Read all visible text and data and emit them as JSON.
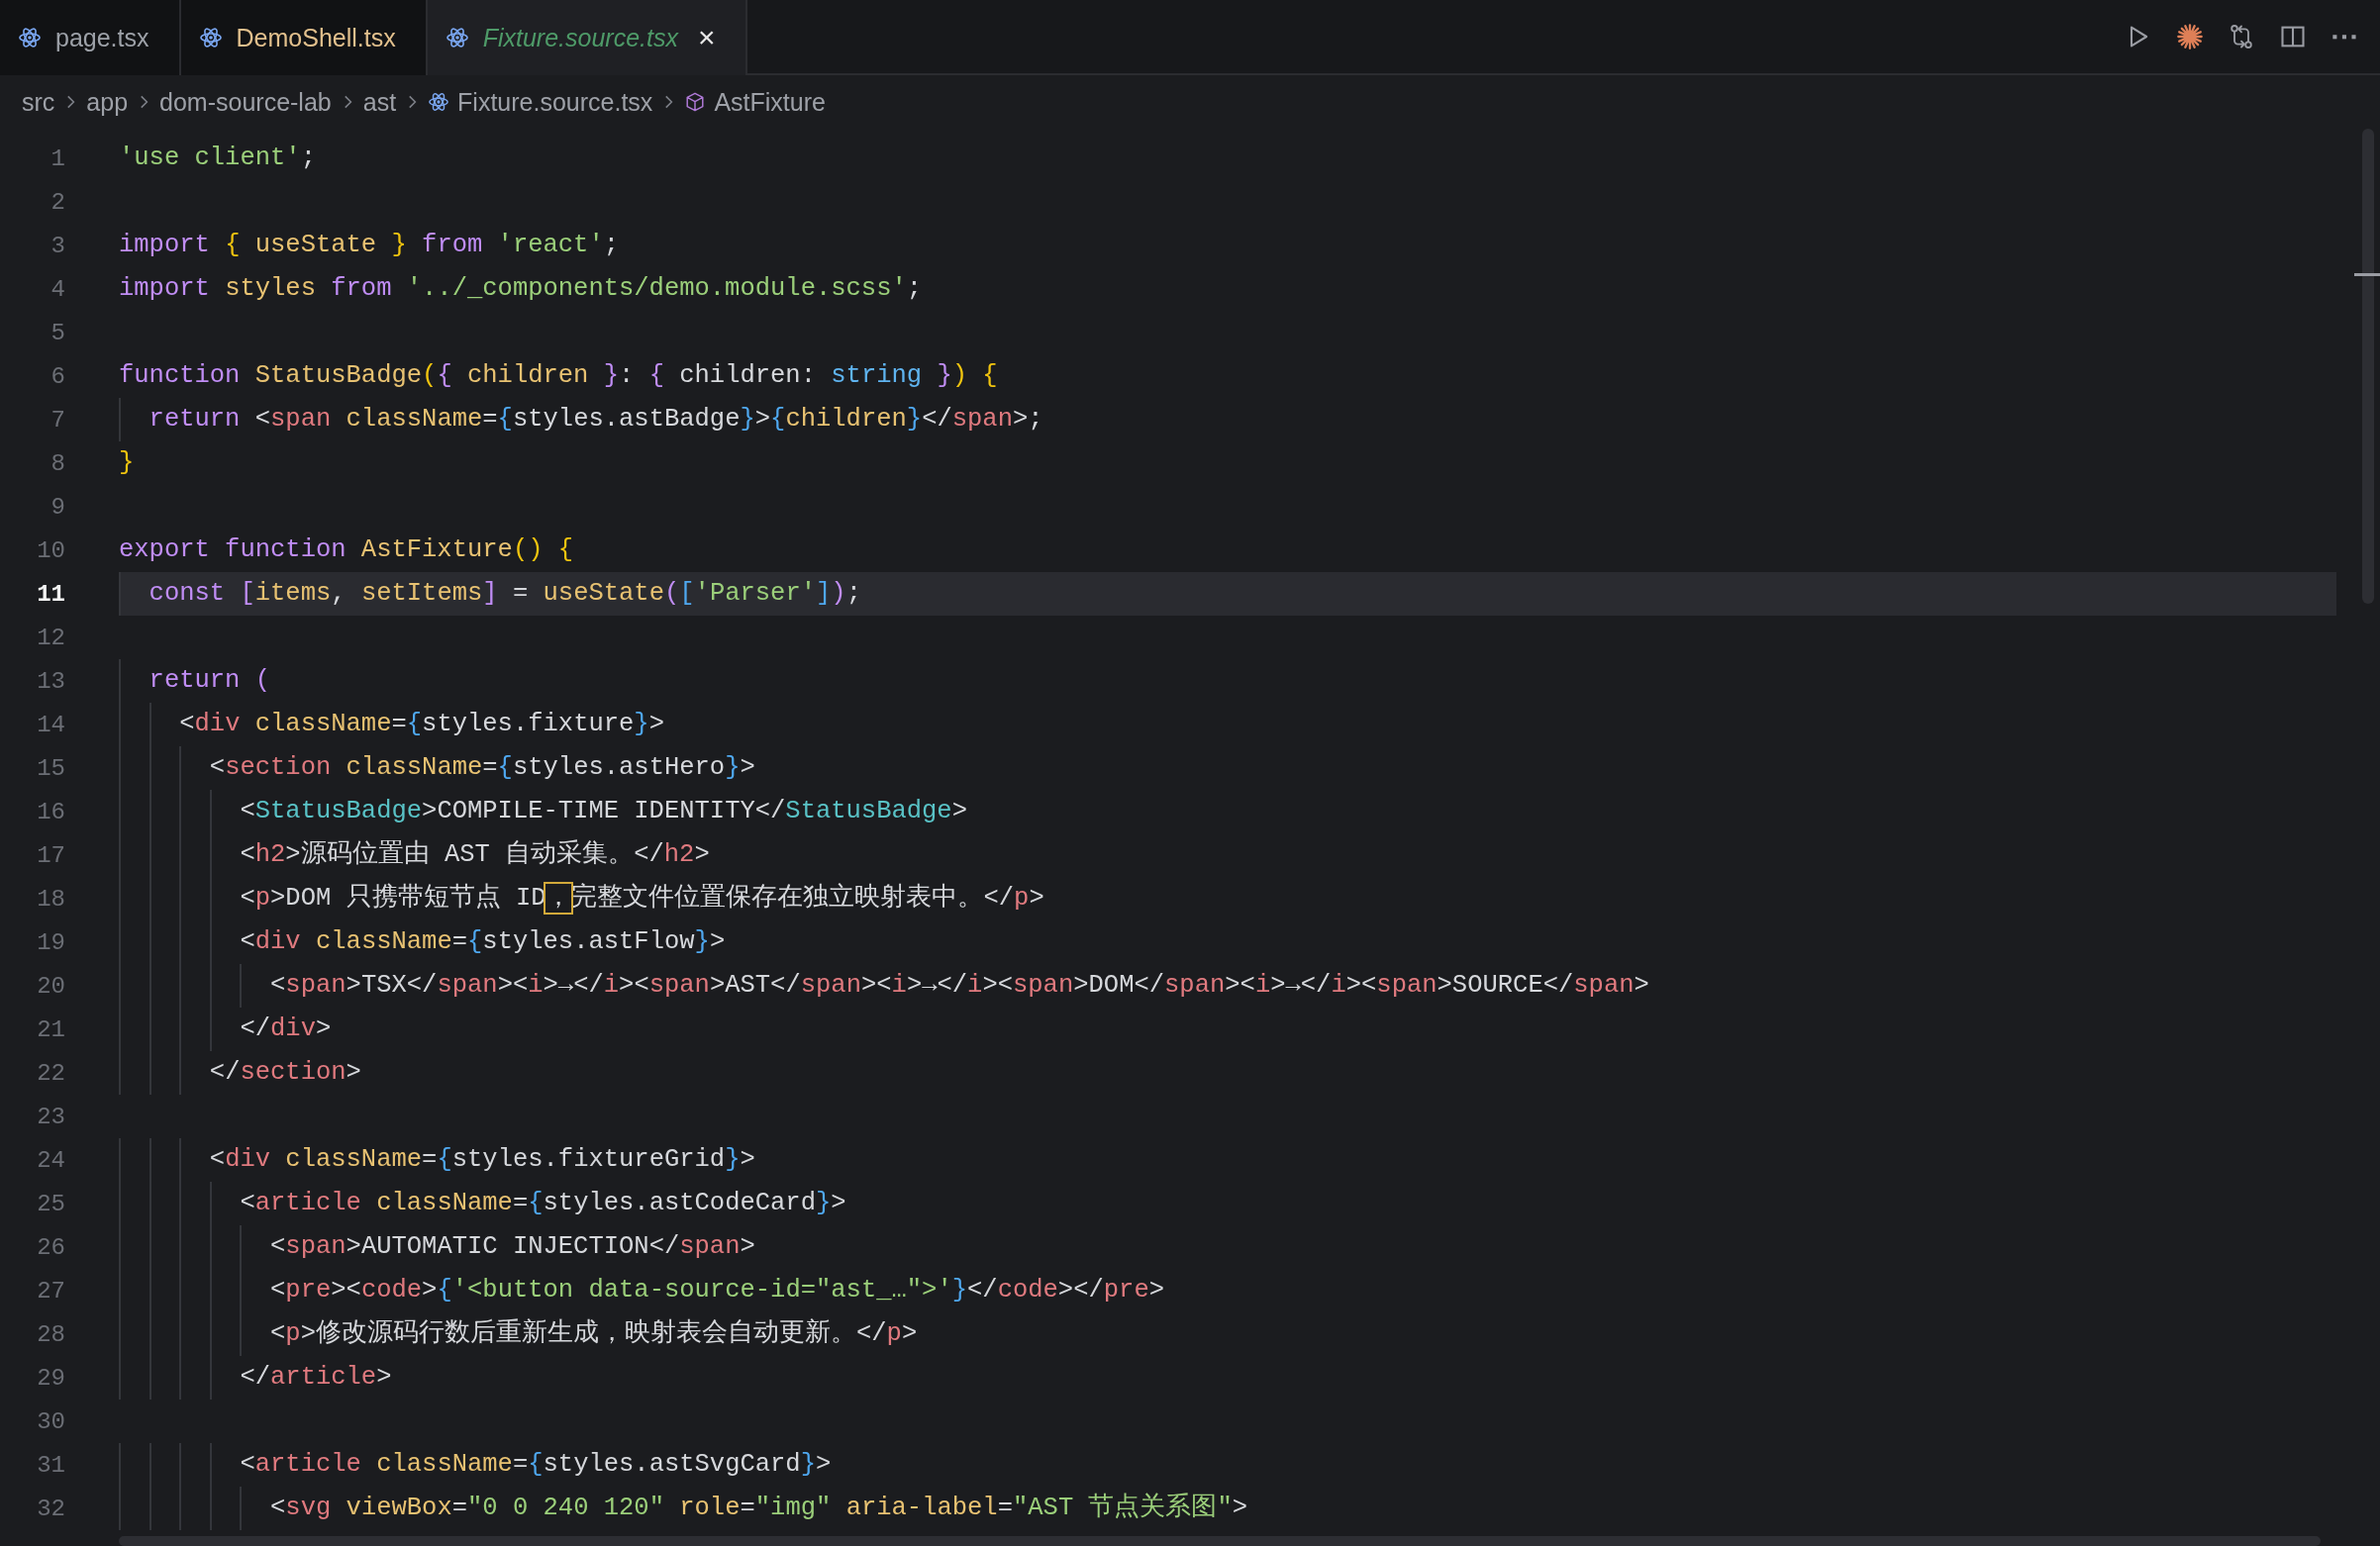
{
  "tabs": [
    {
      "label": "page.tsx",
      "selected": false,
      "preview": false,
      "color": "#9da1a8"
    },
    {
      "label": "DemoShell.tsx",
      "selected": false,
      "preview": false,
      "color": "#e2c08d"
    },
    {
      "label": "Fixture.source.tsx",
      "selected": true,
      "preview": true,
      "color": "#4e9a68",
      "close": "×"
    }
  ],
  "breadcrumb": [
    {
      "label": "src",
      "kind": "folder"
    },
    {
      "label": "app",
      "kind": "folder"
    },
    {
      "label": "dom-source-lab",
      "kind": "folder"
    },
    {
      "label": "ast",
      "kind": "folder"
    },
    {
      "label": "Fixture.source.tsx",
      "kind": "file"
    },
    {
      "label": "AstFixture",
      "kind": "symbol"
    }
  ],
  "lines": [
    {
      "number": "1",
      "current": false,
      "tokens": [
        {
          "kind": "s",
          "text": "'use client'"
        },
        {
          "kind": "p",
          "text": ";"
        }
      ]
    },
    {
      "number": "2",
      "current": false
    },
    {
      "number": "3",
      "current": false,
      "tokens": [
        {
          "kind": "k",
          "text": "import "
        },
        {
          "kind": "b1",
          "text": "{ "
        },
        {
          "kind": "v",
          "text": "useState "
        },
        {
          "kind": "b1",
          "text": "} "
        },
        {
          "kind": "k",
          "text": "from "
        },
        {
          "kind": "s",
          "text": "'react'"
        },
        {
          "kind": "p",
          "text": ";"
        }
      ]
    },
    {
      "number": "4",
      "current": false,
      "tokens": [
        {
          "kind": "k",
          "text": "import "
        },
        {
          "kind": "v",
          "text": "styles "
        },
        {
          "kind": "k",
          "text": "from "
        },
        {
          "kind": "s",
          "text": "'../_components/demo.module.scss'"
        },
        {
          "kind": "p",
          "text": ";"
        }
      ]
    },
    {
      "number": "5",
      "current": false
    },
    {
      "number": "6",
      "current": false,
      "tokens": [
        {
          "kind": "k",
          "text": "function "
        },
        {
          "kind": "f",
          "text": "StatusBadge"
        },
        {
          "kind": "b1",
          "text": "("
        },
        {
          "kind": "b2",
          "text": "{ "
        },
        {
          "kind": "v",
          "text": "children "
        },
        {
          "kind": "b2",
          "text": "}"
        },
        {
          "kind": "p",
          "text": ": "
        },
        {
          "kind": "b2",
          "text": "{ "
        },
        {
          "kind": "p",
          "text": "children: "
        },
        {
          "kind": "ty",
          "text": "string "
        },
        {
          "kind": "b2",
          "text": "}"
        },
        {
          "kind": "b1",
          "text": ") {"
        }
      ]
    },
    {
      "number": "7",
      "current": false,
      "tokens": [
        {
          "kind": "k",
          "text": "  return "
        },
        {
          "kind": "p",
          "text": "<"
        },
        {
          "kind": "t",
          "text": "span "
        },
        {
          "kind": "a",
          "text": "className"
        },
        {
          "kind": "p",
          "text": "="
        },
        {
          "kind": "b3",
          "text": "{"
        },
        {
          "kind": "p",
          "text": "styles.astBadge"
        },
        {
          "kind": "b3",
          "text": "}"
        },
        {
          "kind": "p",
          "text": ">"
        },
        {
          "kind": "b3",
          "text": "{"
        },
        {
          "kind": "v",
          "text": "children"
        },
        {
          "kind": "b3",
          "text": "}"
        },
        {
          "kind": "p",
          "text": "</"
        },
        {
          "kind": "t",
          "text": "span"
        },
        {
          "kind": "p",
          "text": ">;"
        }
      ]
    },
    {
      "number": "8",
      "current": false,
      "tokens": [
        {
          "kind": "b1",
          "text": "}"
        }
      ]
    },
    {
      "number": "9",
      "current": false
    },
    {
      "number": "10",
      "current": false,
      "tokens": [
        {
          "kind": "k",
          "text": "export function "
        },
        {
          "kind": "f",
          "text": "AstFixture"
        },
        {
          "kind": "b1",
          "text": "() {"
        }
      ]
    },
    {
      "number": "11",
      "current": true,
      "tokens": [
        {
          "kind": "k",
          "text": "  const "
        },
        {
          "kind": "b2",
          "text": "["
        },
        {
          "kind": "v",
          "text": "items"
        },
        {
          "kind": "p",
          "text": ", "
        },
        {
          "kind": "v",
          "text": "setItems"
        },
        {
          "kind": "b2",
          "text": "]"
        },
        {
          "kind": "p",
          "text": " = "
        },
        {
          "kind": "f",
          "text": "useState"
        },
        {
          "kind": "b2",
          "text": "("
        },
        {
          "kind": "b3",
          "text": "["
        },
        {
          "kind": "s",
          "text": "'Parser'"
        },
        {
          "kind": "b3",
          "text": "]"
        },
        {
          "kind": "b2",
          "text": ")"
        },
        {
          "kind": "p",
          "text": ";"
        }
      ]
    },
    {
      "number": "12",
      "current": false
    },
    {
      "number": "13",
      "current": false,
      "tokens": [
        {
          "kind": "k",
          "text": "  return "
        },
        {
          "kind": "b2",
          "text": "("
        }
      ]
    },
    {
      "number": "14",
      "current": false,
      "tokens": [
        {
          "kind": "p",
          "text": "    <"
        },
        {
          "kind": "t",
          "text": "div "
        },
        {
          "kind": "a",
          "text": "className"
        },
        {
          "kind": "p",
          "text": "="
        },
        {
          "kind": "b3",
          "text": "{"
        },
        {
          "kind": "p",
          "text": "styles.fixture"
        },
        {
          "kind": "b3",
          "text": "}"
        },
        {
          "kind": "p",
          "text": ">"
        }
      ]
    },
    {
      "number": "15",
      "current": false,
      "tokens": [
        {
          "kind": "p",
          "text": "      <"
        },
        {
          "kind": "t",
          "text": "section "
        },
        {
          "kind": "a",
          "text": "className"
        },
        {
          "kind": "p",
          "text": "="
        },
        {
          "kind": "b3",
          "text": "{"
        },
        {
          "kind": "p",
          "text": "styles.astHero"
        },
        {
          "kind": "b3",
          "text": "}"
        },
        {
          "kind": "p",
          "text": ">"
        }
      ]
    },
    {
      "number": "16",
      "current": false,
      "tokens": [
        {
          "kind": "p",
          "text": "        <"
        },
        {
          "kind": "c",
          "text": "StatusBadge"
        },
        {
          "kind": "p",
          "text": ">COMPILE-TIME IDENTITY</"
        },
        {
          "kind": "c",
          "text": "StatusBadge"
        },
        {
          "kind": "p",
          "text": ">"
        }
      ]
    },
    {
      "number": "17",
      "current": false,
      "tokens": [
        {
          "kind": "p",
          "text": "        <"
        },
        {
          "kind": "t",
          "text": "h2"
        },
        {
          "kind": "p",
          "text": ">源码位置由 AST 自动采集。</"
        },
        {
          "kind": "t",
          "text": "h2"
        },
        {
          "kind": "p",
          "text": ">"
        }
      ]
    },
    {
      "number": "18",
      "current": false,
      "tokens": [
        {
          "kind": "p",
          "text": "        <"
        },
        {
          "kind": "t",
          "text": "p"
        },
        {
          "kind": "p",
          "text": ">DOM 只携带短节点 ID"
        },
        {
          "kind": "x",
          "text": "，"
        },
        {
          "kind": "p",
          "text": "完整文件位置保存在独立映射表中。</"
        },
        {
          "kind": "t",
          "text": "p"
        },
        {
          "kind": "p",
          "text": ">"
        }
      ]
    },
    {
      "number": "19",
      "current": false,
      "tokens": [
        {
          "kind": "p",
          "text": "        <"
        },
        {
          "kind": "t",
          "text": "div "
        },
        {
          "kind": "a",
          "text": "className"
        },
        {
          "kind": "p",
          "text": "="
        },
        {
          "kind": "b3",
          "text": "{"
        },
        {
          "kind": "p",
          "text": "styles.astFlow"
        },
        {
          "kind": "b3",
          "text": "}"
        },
        {
          "kind": "p",
          "text": ">"
        }
      ]
    },
    {
      "number": "20",
      "current": false,
      "tokens": [
        {
          "kind": "p",
          "text": "          <"
        },
        {
          "kind": "t",
          "text": "span"
        },
        {
          "kind": "p",
          "text": ">TSX</"
        },
        {
          "kind": "t",
          "text": "span"
        },
        {
          "kind": "p",
          "text": "><"
        },
        {
          "kind": "t",
          "text": "i"
        },
        {
          "kind": "p",
          "text": ">→</"
        },
        {
          "kind": "t",
          "text": "i"
        },
        {
          "kind": "p",
          "text": "><"
        },
        {
          "kind": "t",
          "text": "span"
        },
        {
          "kind": "p",
          "text": ">AST</"
        },
        {
          "kind": "t",
          "text": "span"
        },
        {
          "kind": "p",
          "text": "><"
        },
        {
          "kind": "t",
          "text": "i"
        },
        {
          "kind": "p",
          "text": ">→</"
        },
        {
          "kind": "t",
          "text": "i"
        },
        {
          "kind": "p",
          "text": "><"
        },
        {
          "kind": "t",
          "text": "span"
        },
        {
          "kind": "p",
          "text": ">DOM</"
        },
        {
          "kind": "t",
          "text": "span"
        },
        {
          "kind": "p",
          "text": "><"
        },
        {
          "kind": "t",
          "text": "i"
        },
        {
          "kind": "p",
          "text": ">→</"
        },
        {
          "kind": "t",
          "text": "i"
        },
        {
          "kind": "p",
          "text": "><"
        },
        {
          "kind": "t",
          "text": "span"
        },
        {
          "kind": "p",
          "text": ">SOURCE</"
        },
        {
          "kind": "t",
          "text": "span"
        },
        {
          "kind": "p",
          "text": ">"
        }
      ]
    },
    {
      "number": "21",
      "current": false,
      "tokens": [
        {
          "kind": "p",
          "text": "        </"
        },
        {
          "kind": "t",
          "text": "div"
        },
        {
          "kind": "p",
          "text": ">"
        }
      ]
    },
    {
      "number": "22",
      "current": false,
      "tokens": [
        {
          "kind": "p",
          "text": "      </"
        },
        {
          "kind": "t",
          "text": "section"
        },
        {
          "kind": "p",
          "text": ">"
        }
      ]
    },
    {
      "number": "23",
      "current": false
    },
    {
      "number": "24",
      "current": false,
      "tokens": [
        {
          "kind": "p",
          "text": "      <"
        },
        {
          "kind": "t",
          "text": "div "
        },
        {
          "kind": "a",
          "text": "className"
        },
        {
          "kind": "p",
          "text": "="
        },
        {
          "kind": "b3",
          "text": "{"
        },
        {
          "kind": "p",
          "text": "styles.fixtureGrid"
        },
        {
          "kind": "b3",
          "text": "}"
        },
        {
          "kind": "p",
          "text": ">"
        }
      ]
    },
    {
      "number": "25",
      "current": false,
      "tokens": [
        {
          "kind": "p",
          "text": "        <"
        },
        {
          "kind": "t",
          "text": "article "
        },
        {
          "kind": "a",
          "text": "className"
        },
        {
          "kind": "p",
          "text": "="
        },
        {
          "kind": "b3",
          "text": "{"
        },
        {
          "kind": "p",
          "text": "styles.astCodeCard"
        },
        {
          "kind": "b3",
          "text": "}"
        },
        {
          "kind": "p",
          "text": ">"
        }
      ]
    },
    {
      "number": "26",
      "current": false,
      "tokens": [
        {
          "kind": "p",
          "text": "          <"
        },
        {
          "kind": "t",
          "text": "span"
        },
        {
          "kind": "p",
          "text": ">AUTOMATIC INJECTION</"
        },
        {
          "kind": "t",
          "text": "span"
        },
        {
          "kind": "p",
          "text": ">"
        }
      ]
    },
    {
      "number": "27",
      "current": false,
      "tokens": [
        {
          "kind": "p",
          "text": "          <"
        },
        {
          "kind": "t",
          "text": "pre"
        },
        {
          "kind": "p",
          "text": "><"
        },
        {
          "kind": "t",
          "text": "code"
        },
        {
          "kind": "p",
          "text": ">"
        },
        {
          "kind": "b3",
          "text": "{"
        },
        {
          "kind": "s",
          "text": "'<button data-source-id=\"ast_…\">'"
        },
        {
          "kind": "b3",
          "text": "}"
        },
        {
          "kind": "p",
          "text": "</"
        },
        {
          "kind": "t",
          "text": "code"
        },
        {
          "kind": "p",
          "text": "></"
        },
        {
          "kind": "t",
          "text": "pre"
        },
        {
          "kind": "p",
          "text": ">"
        }
      ]
    },
    {
      "number": "28",
      "current": false,
      "tokens": [
        {
          "kind": "p",
          "text": "          <"
        },
        {
          "kind": "t",
          "text": "p"
        },
        {
          "kind": "p",
          "text": ">修改源码行数后重新生成，映射表会自动更新。</"
        },
        {
          "kind": "t",
          "text": "p"
        },
        {
          "kind": "p",
          "text": ">"
        }
      ]
    },
    {
      "number": "29",
      "current": false,
      "tokens": [
        {
          "kind": "p",
          "text": "        </"
        },
        {
          "kind": "t",
          "text": "article"
        },
        {
          "kind": "p",
          "text": ">"
        }
      ]
    },
    {
      "number": "30",
      "current": false
    },
    {
      "number": "31",
      "current": false,
      "tokens": [
        {
          "kind": "p",
          "text": "        <"
        },
        {
          "kind": "t",
          "text": "article "
        },
        {
          "kind": "a",
          "text": "className"
        },
        {
          "kind": "p",
          "text": "="
        },
        {
          "kind": "b3",
          "text": "{"
        },
        {
          "kind": "p",
          "text": "styles.astSvgCard"
        },
        {
          "kind": "b3",
          "text": "}"
        },
        {
          "kind": "p",
          "text": ">"
        }
      ]
    },
    {
      "number": "32",
      "current": false,
      "tokens": [
        {
          "kind": "p",
          "text": "          <"
        },
        {
          "kind": "t",
          "text": "svg "
        },
        {
          "kind": "a",
          "text": "viewBox"
        },
        {
          "kind": "p",
          "text": "="
        },
        {
          "kind": "s",
          "text": "\"0 0 240 120\" "
        },
        {
          "kind": "a",
          "text": "role"
        },
        {
          "kind": "p",
          "text": "="
        },
        {
          "kind": "s",
          "text": "\"img\" "
        },
        {
          "kind": "a",
          "text": "aria-label"
        },
        {
          "kind": "p",
          "text": "="
        },
        {
          "kind": "s",
          "text": "\"AST 节点关系图\""
        },
        {
          "kind": "p",
          "text": ">"
        }
      ]
    }
  ]
}
